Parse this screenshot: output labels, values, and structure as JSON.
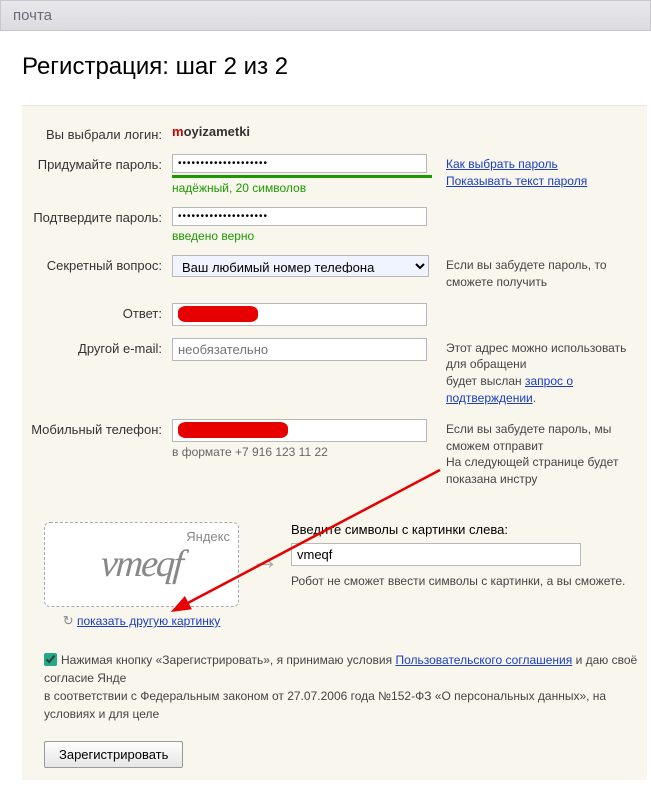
{
  "topbar": {
    "title": "почта"
  },
  "heading": "Регистрация: шаг 2 из 2",
  "labels": {
    "login": "Вы выбрали логин:",
    "password": "Придумайте пароль:",
    "confirm": "Подтвердите пароль:",
    "secret_q": "Секретный вопрос:",
    "answer": "Ответ:",
    "other_email": "Другой e-mail:",
    "phone": "Мобильный телефон:"
  },
  "login": {
    "first_letter": "m",
    "rest": "oyizametki"
  },
  "password": {
    "value": "••••••••••••••••••••",
    "strength_text": "надёжный, 20 символов",
    "help_link": "Как выбрать пароль",
    "show_link": "Показывать текст пароля"
  },
  "confirm": {
    "value": "••••••••••••••••••••",
    "ok_text": "введено верно"
  },
  "secret_q": {
    "selected": "Ваш любимый номер телефона",
    "hint": "Если вы забудете пароль, то сможете получить"
  },
  "other_email": {
    "placeholder": "необязательно",
    "hint_line1": "Этот адрес можно использовать для обращени",
    "hint_line2_prefix": "будет выслан ",
    "hint_link": "запрос о подтверждении",
    "hint_line2_suffix": "."
  },
  "phone": {
    "format_hint": "в формате +7 916 123 11 22",
    "hint_line1": "Если вы забудете пароль, мы сможем отправит",
    "hint_line2": "На следующей странице будет показана инстру"
  },
  "captcha": {
    "brand": "Яндекс",
    "distorted_text": "vmeqf",
    "refresh_text": "показать другую картинку",
    "label": "Введите символы с картинки слева:",
    "input_value": "vmeqf",
    "hint": "Робот не сможет ввести символы с картинки, а вы сможете."
  },
  "agree": {
    "text_before_link1": "Нажимая кнопку «Зарегистрировать», я принимаю условия ",
    "link1": "Пользовательского соглашения",
    "text_after_link1": " и даю своё согласие Янде",
    "line2": "в соответствии с Федеральным законом от 27.07.2006 года №152-ФЗ «О персональных данных», на условиях и для целе"
  },
  "submit": {
    "label": "Зарегистрировать"
  }
}
